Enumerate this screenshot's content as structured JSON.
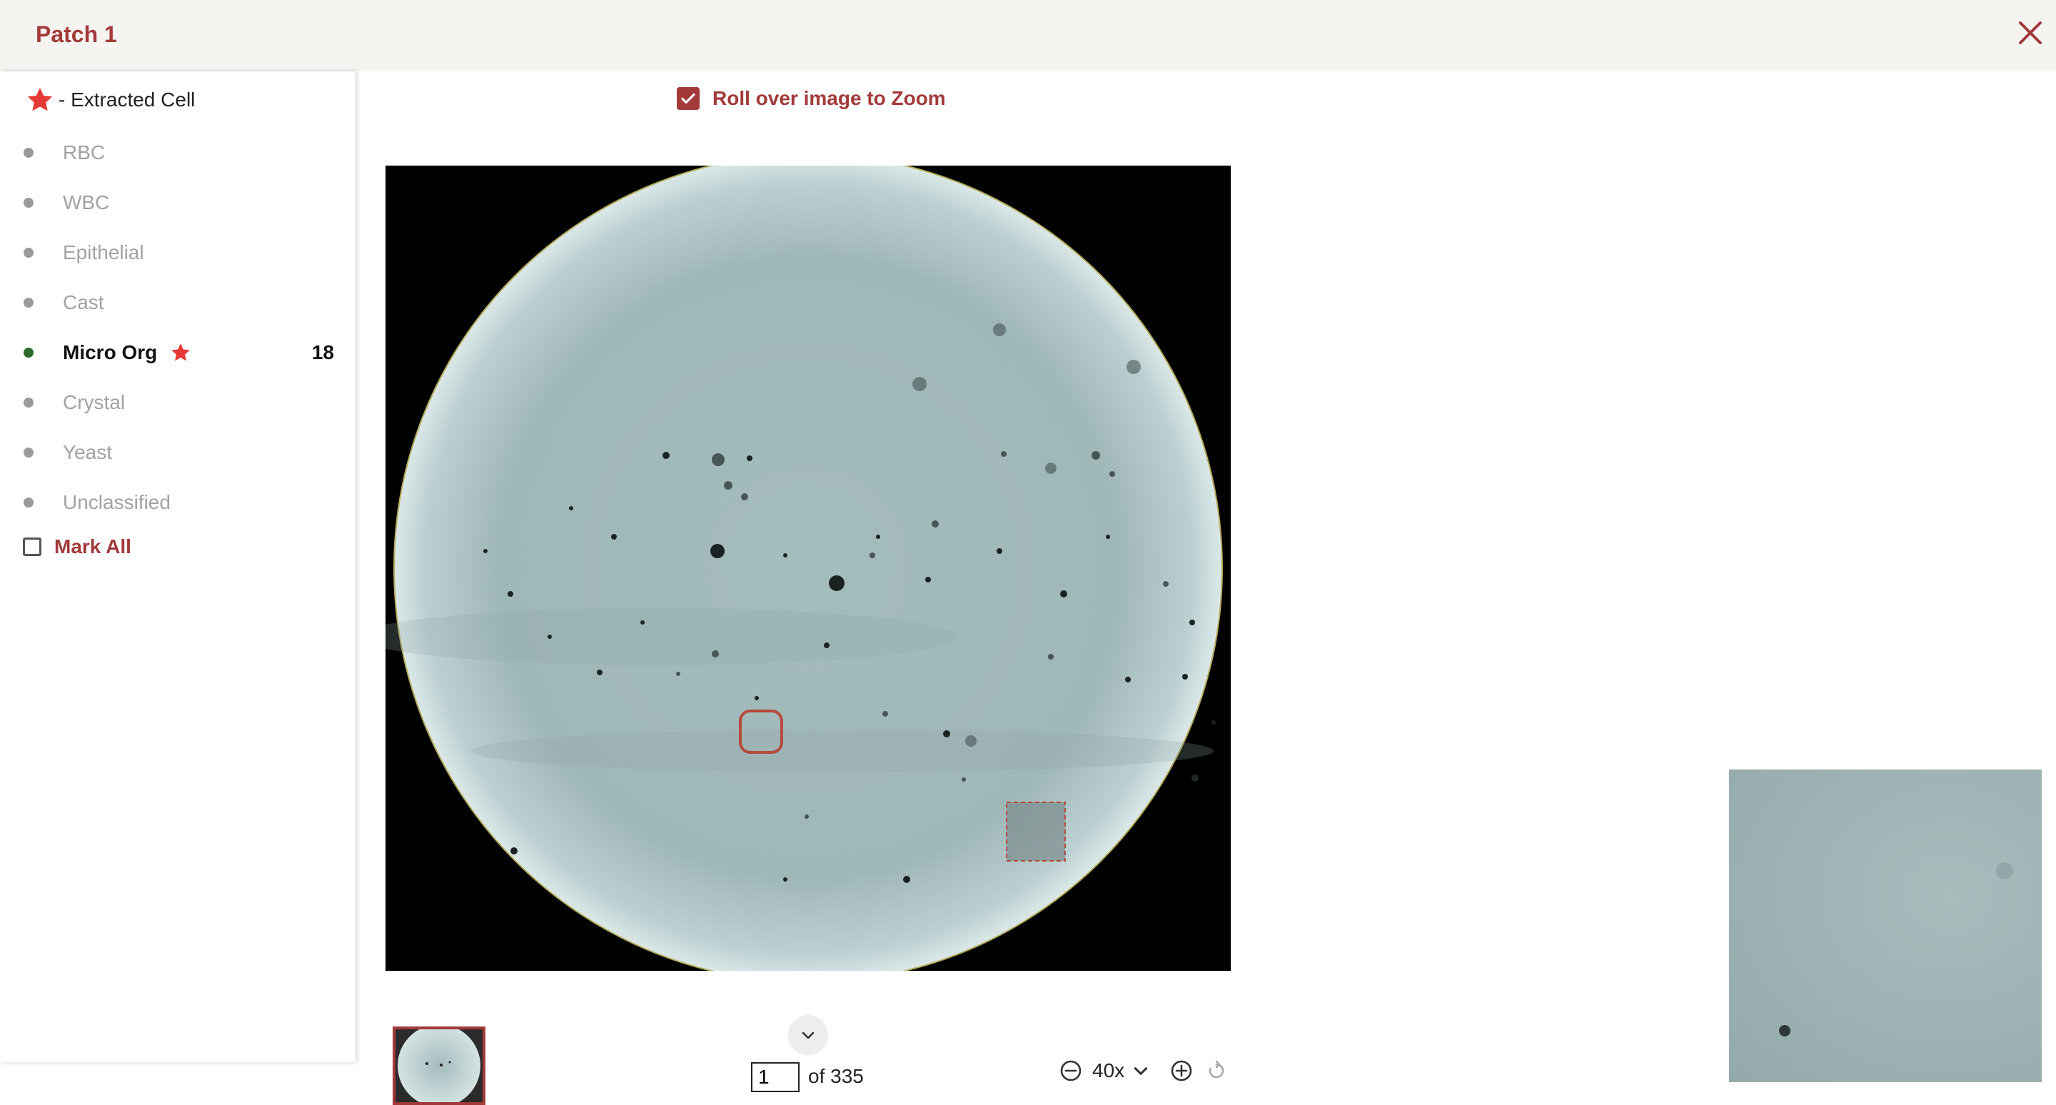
{
  "header": {
    "title": "Patch 1",
    "close_icon": "close-icon"
  },
  "legend": {
    "icon": "star-icon",
    "text": "- Extracted Cell",
    "color": "#e53935"
  },
  "cell_classes": [
    {
      "label": "RBC",
      "active": false,
      "starred": false,
      "count": ""
    },
    {
      "label": "WBC",
      "active": false,
      "starred": false,
      "count": ""
    },
    {
      "label": "Epithelial",
      "active": false,
      "starred": false,
      "count": ""
    },
    {
      "label": "Cast",
      "active": false,
      "starred": false,
      "count": ""
    },
    {
      "label": "Micro Org",
      "active": true,
      "starred": true,
      "count": "18"
    },
    {
      "label": "Crystal",
      "active": false,
      "starred": false,
      "count": ""
    },
    {
      "label": "Yeast",
      "active": false,
      "starred": false,
      "count": ""
    },
    {
      "label": "Unclassified",
      "active": false,
      "starred": false,
      "count": ""
    }
  ],
  "mark_all": {
    "label": "Mark All",
    "checked": false
  },
  "zoom_toggle": {
    "label": "Roll over image to Zoom",
    "checked": true
  },
  "pagination": {
    "current_page": "1",
    "total_text": "of 335"
  },
  "zoom": {
    "level": "40x"
  },
  "colors": {
    "accent": "#a33a3a",
    "active_dot": "#2e6b2a",
    "inactive_text": "#a2a2a2",
    "header_bg": "#f5f4f1"
  }
}
